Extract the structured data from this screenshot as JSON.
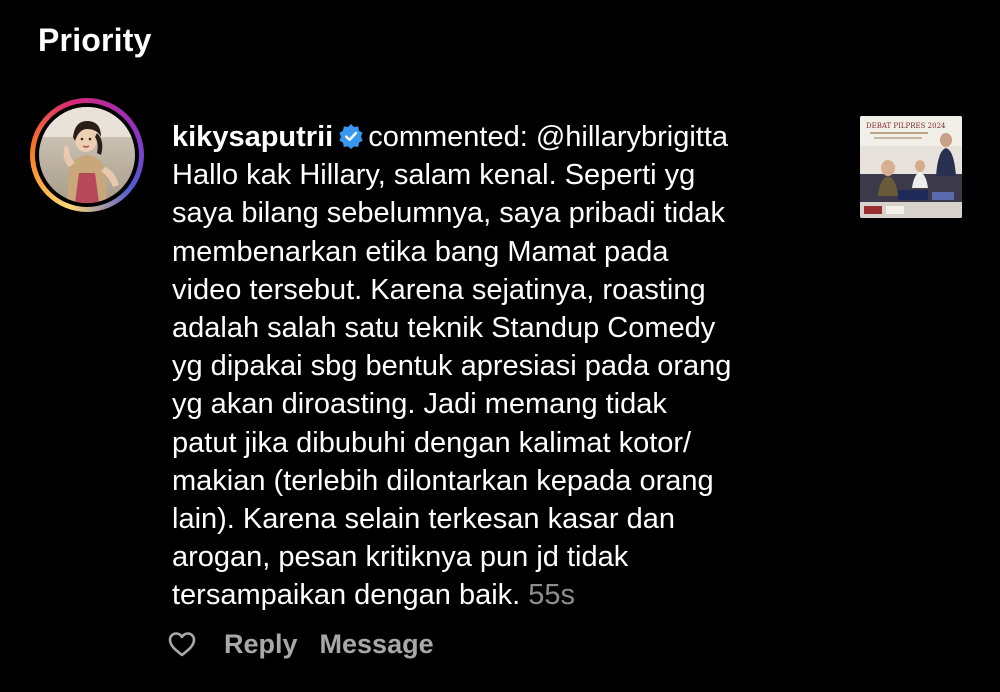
{
  "section": {
    "title": "Priority"
  },
  "notification": {
    "username": "kikysaputrii",
    "verified": true,
    "action": "commented:",
    "mention": "@hillarybrigitta",
    "lines": [
      "Hallo kak Hillary, salam kenal. Seperti yg",
      "saya bilang sebelumnya, saya pribadi tidak",
      "membenarkan etika bang Mamat pada",
      "video tersebut. Karena sejatinya, roasting",
      "adalah salah satu teknik Standup Comedy",
      "yg dipakai sbg bentuk apresiasi pada orang",
      "yg akan diroasting. Jadi memang tidak",
      "patut jika dibubuhi dengan kalimat kotor/",
      "makian (terlebih dilontarkan kepada orang",
      "lain). Karena selain terkesan kasar dan",
      "arogan, pesan kritiknya pun jd tidak",
      "tersampaikan dengan baik."
    ],
    "time": "55s",
    "thumbnail_caption": "DEBAT PILPRES 2024"
  },
  "actions": {
    "reply_label": "Reply",
    "message_label": "Message",
    "like_icon": "heart-outline-icon"
  },
  "colors": {
    "background": "#000000",
    "text": "#ffffff",
    "muted": "#8e8e8e",
    "verified_badge": "#3897f0"
  }
}
